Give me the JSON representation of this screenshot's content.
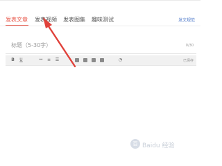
{
  "tabs": [
    {
      "label": "发表文章",
      "active": true
    },
    {
      "label": "发表视频",
      "active": false
    },
    {
      "label": "发表图集",
      "active": false
    },
    {
      "label": "趣味测试",
      "active": false
    }
  ],
  "side_link": "发文规范",
  "title_field": {
    "placeholder": "标题（5-30字）",
    "counter": "0/30"
  },
  "toolbar": {
    "bold": "B",
    "underline": "U",
    "autosave": "已保存"
  },
  "watermark": {
    "logo_text": "百",
    "text": "Baidu 经验"
  },
  "colors": {
    "accent": "#e8574a",
    "arrow": "#e0413a",
    "link": "#4a76c8"
  }
}
